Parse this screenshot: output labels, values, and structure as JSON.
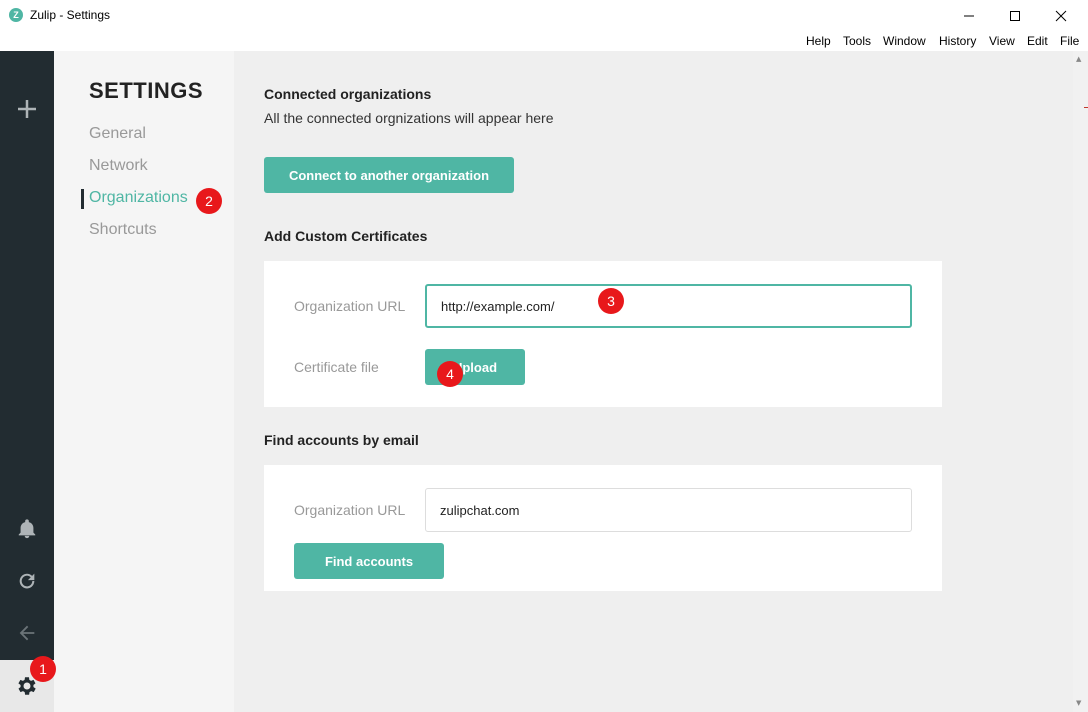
{
  "window": {
    "title": "Zulip - Settings",
    "logo_letter": "Z"
  },
  "menu": [
    "Help",
    "Tools",
    "Window",
    "History",
    "View",
    "Edit",
    "File"
  ],
  "nav": {
    "title": "SETTINGS",
    "items": [
      {
        "label": "General",
        "active": false
      },
      {
        "label": "Network",
        "active": false
      },
      {
        "label": "Organizations",
        "active": true
      },
      {
        "label": "Shortcuts",
        "active": false
      }
    ]
  },
  "connected": {
    "title": "Connected organizations",
    "subtitle": "All the connected orgnizations will appear here",
    "connect_button": "Connect to another organization"
  },
  "certificates": {
    "title": "Add Custom Certificates",
    "url_label": "Organization URL",
    "url_value": "http://example.com/",
    "file_label": "Certificate file",
    "upload_button": "Upload"
  },
  "find_accounts": {
    "title": "Find accounts by email",
    "url_label": "Organization URL",
    "url_value": "zulipchat.com",
    "find_button": "Find accounts"
  },
  "markers": [
    "1",
    "2",
    "3",
    "4"
  ],
  "colors": {
    "accent": "#4fb6a4",
    "sidebar": "#222c31",
    "marker": "#e8181b"
  }
}
